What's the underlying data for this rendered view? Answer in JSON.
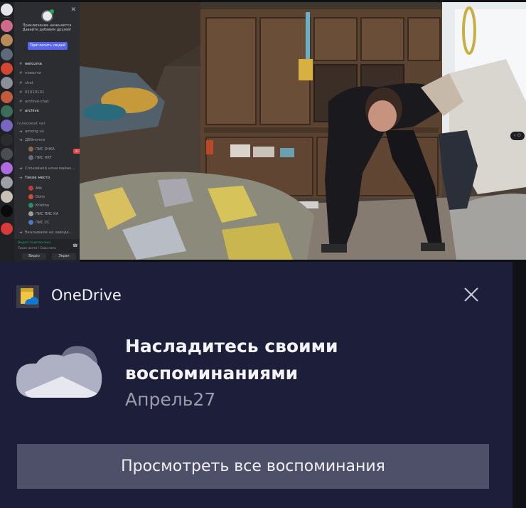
{
  "discord": {
    "invite": {
      "title_line1": "Приключение начинается",
      "title_line2": "Давайте добавим друзей!",
      "button": "Пригласить людей"
    },
    "text_channels": [
      {
        "name": "welcome"
      },
      {
        "name": "новости"
      },
      {
        "name": "chat"
      },
      {
        "name": "01010101"
      },
      {
        "name": "archive-chat"
      },
      {
        "name": "archive"
      }
    ],
    "voice_category": "голосовой чат",
    "voice_channels": [
      {
        "name": "among us"
      },
      {
        "name": "ДВ9ночки"
      }
    ],
    "voice_members_1": [
      "ПИС ОЧКА",
      "ПИС НКТ"
    ],
    "live_badge": "В ЭФИРЕ",
    "voice_channels_2": [
      {
        "name": "Спокойной ночи майнк..."
      },
      {
        "name": "Тихое место"
      }
    ],
    "voice_members_2": [
      "Alik",
      "Doris",
      "Kristina",
      "ПИС ПИС КА",
      "ПИС СС"
    ],
    "voice_channels_3": [
      {
        "name": "Вкалываем на заводе..."
      }
    ],
    "voice_status": "Видео подключено",
    "voice_sub": "Тихое место / Свои пати",
    "video_btn": "Видео",
    "screen_btn": "Экран"
  },
  "toast": {
    "app_name": "OneDrive",
    "headline_line1": "Насладитесь своими",
    "headline_line2": "воспоминаниями",
    "date": "Апрель27",
    "action": "Просмотреть все воспоминания",
    "icons": {
      "app": "onedrive-logo-icon",
      "close": "close-icon",
      "hero": "onedrive-cloud-icon"
    },
    "colors": {
      "background": "#1d1e3a",
      "button": "#4e506a",
      "accent_blue": "#0f78d4"
    }
  }
}
